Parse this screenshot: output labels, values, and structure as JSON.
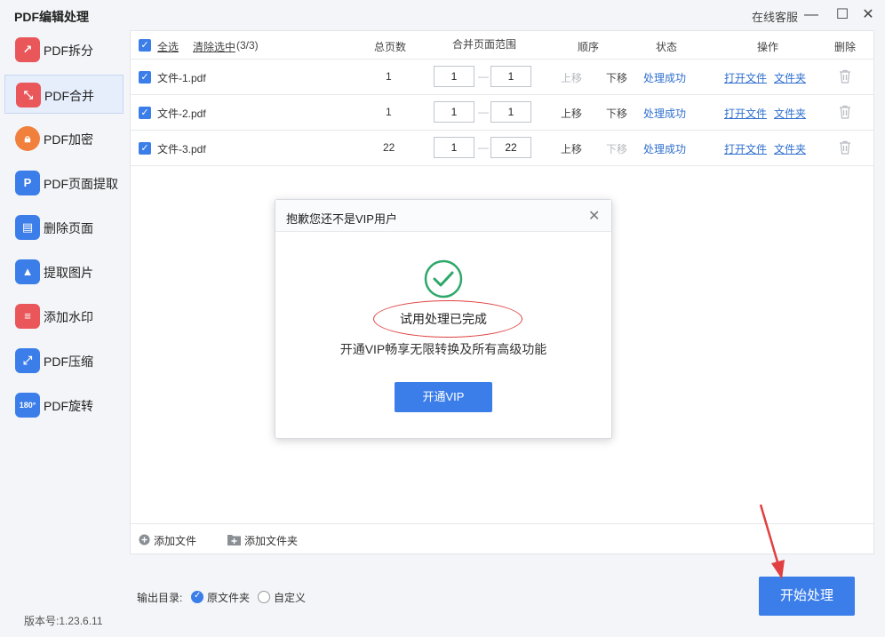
{
  "app": {
    "title": "PDF编辑处理",
    "service": "在线客服"
  },
  "window": {
    "minimize": "—",
    "maximize": "☐",
    "close": "✕"
  },
  "sidebar": {
    "items": [
      {
        "label": "PDF拆分",
        "icon": "split-icon",
        "color": "#e9575a"
      },
      {
        "label": "PDF合并",
        "icon": "merge-icon",
        "color": "#e9575a",
        "active": true
      },
      {
        "label": "PDF加密",
        "icon": "lock-icon",
        "color": "#f0803c"
      },
      {
        "label": "PDF页面提取",
        "icon": "page-extract-icon",
        "color": "#3b7de9"
      },
      {
        "label": "删除页面",
        "icon": "delete-page-icon",
        "color": "#3b7de9"
      },
      {
        "label": "提取图片",
        "icon": "image-extract-icon",
        "color": "#3b7de9"
      },
      {
        "label": "添加水印",
        "icon": "watermark-icon",
        "color": "#e9575a"
      },
      {
        "label": "PDF压缩",
        "icon": "compress-icon",
        "color": "#3b7de9"
      },
      {
        "label": "PDF旋转",
        "icon": "rotate-icon",
        "color": "#3b7de9"
      }
    ],
    "version": "版本号:1.23.6.11"
  },
  "table": {
    "select_all": "全选",
    "clear_selection": "清除选中",
    "selection_count": "(3/3)",
    "headers": {
      "pages": "总页数",
      "range": "合并页面范围",
      "order": "顺序",
      "status": "状态",
      "actions": "操作",
      "delete": "删除"
    },
    "rows": [
      {
        "name": "文件-1.pdf",
        "pages": "1",
        "from": "1",
        "to": "1",
        "up": "上移",
        "down": "下移",
        "status": "处理成功",
        "open": "打开文件",
        "folder": "文件夹"
      },
      {
        "name": "文件-2.pdf",
        "pages": "1",
        "from": "1",
        "to": "1",
        "up": "上移",
        "down": "下移",
        "status": "处理成功",
        "open": "打开文件",
        "folder": "文件夹"
      },
      {
        "name": "文件-3.pdf",
        "pages": "22",
        "from": "1",
        "to": "22",
        "up": "上移",
        "down": "下移",
        "status": "处理成功",
        "open": "打开文件",
        "folder": "文件夹"
      }
    ],
    "add_file": "添加文件",
    "add_folder": "添加文件夹"
  },
  "output": {
    "label": "输出目录:",
    "option_original": "原文件夹",
    "option_custom": "自定义",
    "selected": "原文件夹"
  },
  "start_button": "开始处理",
  "modal": {
    "title": "抱歉您还不是VIP用户",
    "close": "✕",
    "message": "试用处理已完成",
    "submessage": "开通VIP畅享无限转换及所有高级功能",
    "button": "开通VIP"
  },
  "colors": {
    "accent": "#3b7de9",
    "success": "#2ea86a",
    "annotation": "#e04040"
  }
}
